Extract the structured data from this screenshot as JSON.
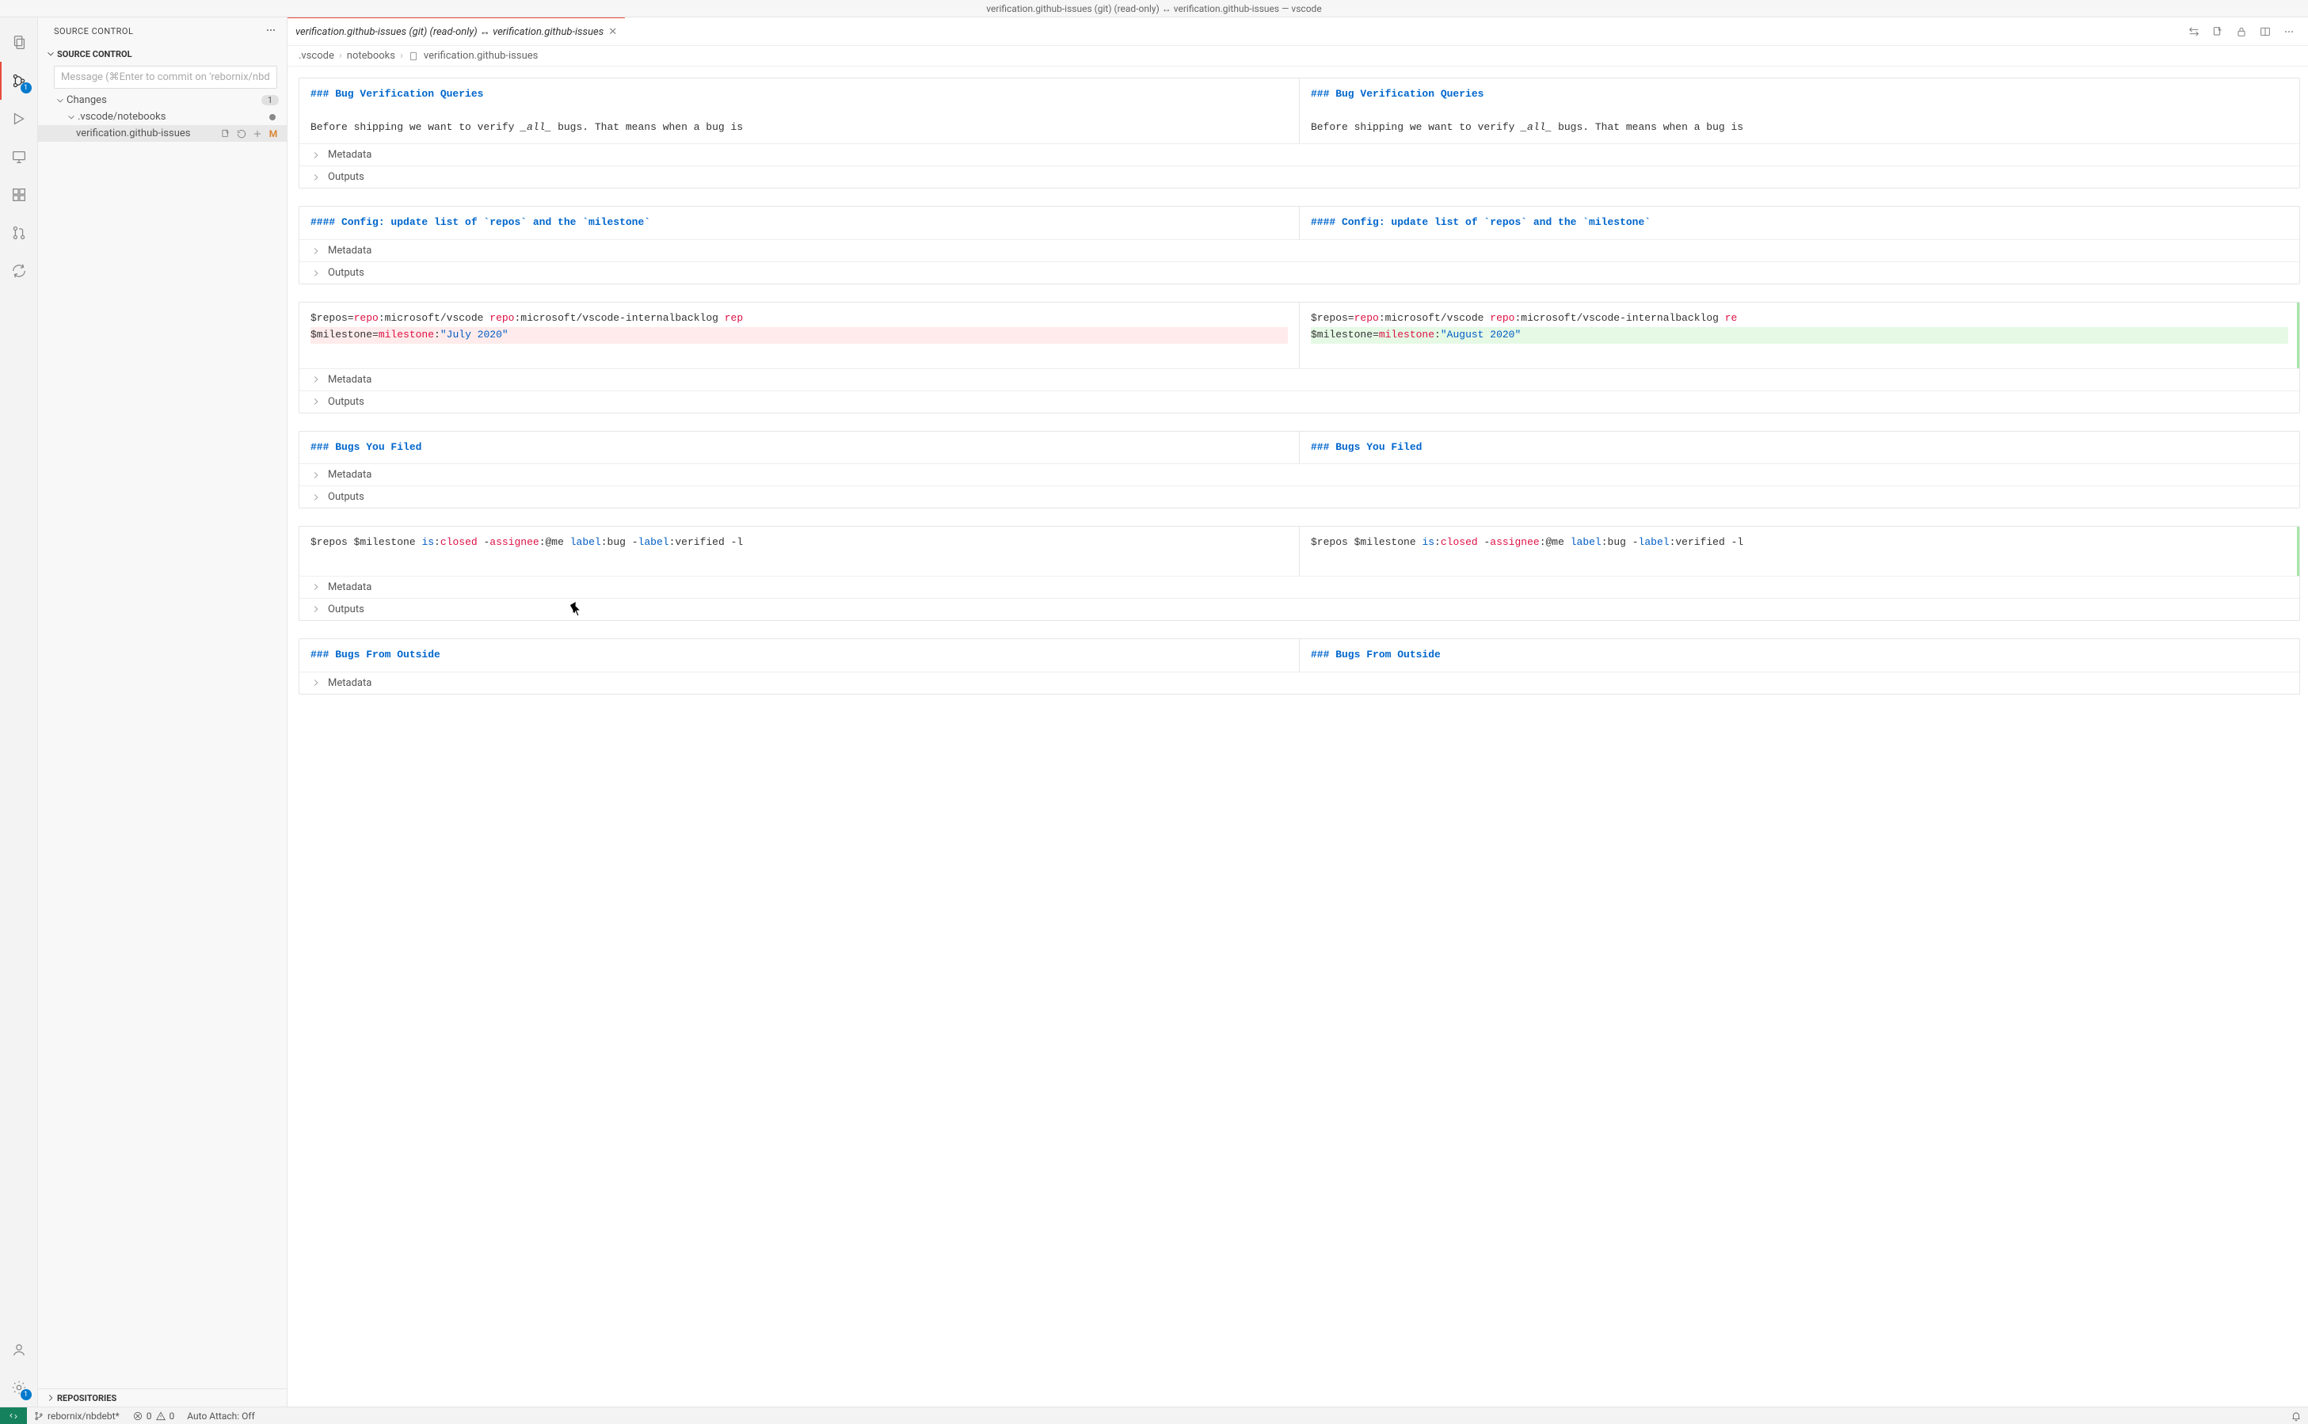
{
  "titlebar": {
    "left": "verification.github-issues (git) (read-only)",
    "sep": "↔",
    "right": "verification.github-issues — vscode"
  },
  "activitybar": {
    "scm_badge": "1",
    "settings_badge": "1"
  },
  "sidebar": {
    "title": "SOURCE CONTROL",
    "section": "SOURCE CONTROL",
    "commit_placeholder": "Message (⌘Enter to commit on 'rebornix/nbde...",
    "changes_label": "Changes",
    "changes_count": "1",
    "folder": ".vscode/notebooks",
    "file": "verification.github-issues",
    "file_status": "M",
    "repositories": "REPOSITORIES"
  },
  "tabs": {
    "active": "verification.github-issues (git) (read-only) ↔ verification.github-issues"
  },
  "breadcrumbs": {
    "seg1": ".vscode",
    "seg2": "notebooks",
    "seg3": "verification.github-issues"
  },
  "labels": {
    "metadata": "Metadata",
    "outputs": "Outputs"
  },
  "cells": [
    {
      "left_heading": "### Bug Verification Queries",
      "right_heading": "### Bug Verification Queries",
      "left_body_pre": "Before shipping we want to verify ",
      "left_body_em": "_all_",
      "left_body_post": " bugs. That means when a bug is",
      "right_body_pre": "Before shipping we want to verify ",
      "right_body_em": "_all_",
      "right_body_post": " bugs. That means when a bug is"
    },
    {
      "left_heading": "#### Config: update list of `repos` and the `milestone`",
      "right_heading": "#### Config: update list of `repos` and the `milestone`"
    },
    {
      "left_line1_a": "$repos=",
      "left_line1_b": "repo",
      "left_line1_c": ":microsoft/vscode ",
      "left_line1_d": "repo",
      "left_line1_e": ":microsoft/vscode-internalbacklog ",
      "left_line1_f": "rep",
      "left_line2_a": "$milestone=",
      "left_line2_b": "milestone",
      "left_line2_c": ":",
      "left_line2_d": "\"July 2020\"",
      "right_line1_a": "$repos=",
      "right_line1_b": "repo",
      "right_line1_c": ":microsoft/vscode ",
      "right_line1_d": "repo",
      "right_line1_e": ":microsoft/vscode-internalbacklog ",
      "right_line1_f": "re",
      "right_line2_a": "$milestone=",
      "right_line2_b": "milestone",
      "right_line2_c": ":",
      "right_line2_d": "\"August 2020\""
    },
    {
      "left_heading": "### Bugs You Filed",
      "right_heading": "### Bugs You Filed"
    },
    {
      "left_a": "$repos $milestone ",
      "left_b": "is",
      "left_c": ":",
      "left_d": "closed",
      "left_e": " -",
      "left_f": "assignee",
      "left_g": ":@me ",
      "left_h": "label",
      "left_i": ":bug -",
      "left_j": "label",
      "left_k": ":verified -l",
      "right_a": "$repos $milestone ",
      "right_b": "is",
      "right_c": ":",
      "right_d": "closed",
      "right_e": " -",
      "right_f": "assignee",
      "right_g": ":@me ",
      "right_h": "label",
      "right_i": ":bug -",
      "right_j": "label",
      "right_k": ":verified -l"
    },
    {
      "left_heading": "### Bugs From Outside",
      "right_heading": "### Bugs From Outside"
    }
  ],
  "statusbar": {
    "branch": "rebornix/nbdebt*",
    "errors": "0",
    "warnings": "0",
    "auto_attach": "Auto Attach: Off"
  }
}
